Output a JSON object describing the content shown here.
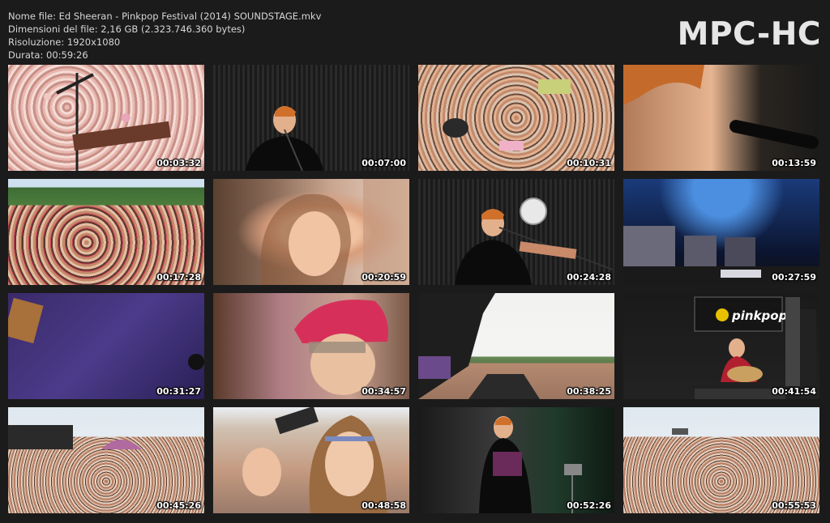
{
  "header": {
    "file_name": "Nome file: Ed Sheeran - Pinkpop Festival (2014) SOUNDSTAGE.mkv",
    "file_size": "Dimensioni del file: 2,16 GB (2.323.746.360 bytes)",
    "resolution": "Risoluzione: 1920x1080",
    "duration": "Durata: 00:59:26"
  },
  "logo": "MPC-HC",
  "thumbnails": [
    {
      "timestamp": "00:03:32"
    },
    {
      "timestamp": "00:07:00"
    },
    {
      "timestamp": "00:10:31"
    },
    {
      "timestamp": "00:13:59"
    },
    {
      "timestamp": "00:17:28"
    },
    {
      "timestamp": "00:20:59"
    },
    {
      "timestamp": "00:24:28"
    },
    {
      "timestamp": "00:27:59"
    },
    {
      "timestamp": "00:31:27"
    },
    {
      "timestamp": "00:34:57"
    },
    {
      "timestamp": "00:38:25"
    },
    {
      "timestamp": "00:41:54"
    },
    {
      "timestamp": "00:45:26"
    },
    {
      "timestamp": "00:48:58"
    },
    {
      "timestamp": "00:52:26"
    },
    {
      "timestamp": "00:55:53"
    }
  ],
  "stage_banner": "pinkpop"
}
